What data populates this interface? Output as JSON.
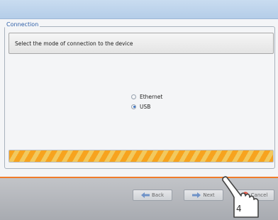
{
  "group": {
    "title": "Connection"
  },
  "instruction": {
    "text": "Select the mode of connection to the device"
  },
  "connection_options": [
    {
      "label": "Ethernet",
      "selected": false
    },
    {
      "label": "USB",
      "selected": true
    }
  ],
  "buttons": {
    "back": "Back",
    "next": "Next",
    "cancel": "Cancel"
  },
  "callout": {
    "number": "4"
  },
  "colors": {
    "accent_orange": "#f07c2a",
    "progress_orange": "#f7a31e",
    "group_title_blue": "#2f5fa8",
    "cancel_red": "#e24b3b"
  },
  "icons": [
    "back-arrow-icon",
    "next-arrow-icon",
    "cancel-x-icon",
    "hand-cursor-icon"
  ]
}
